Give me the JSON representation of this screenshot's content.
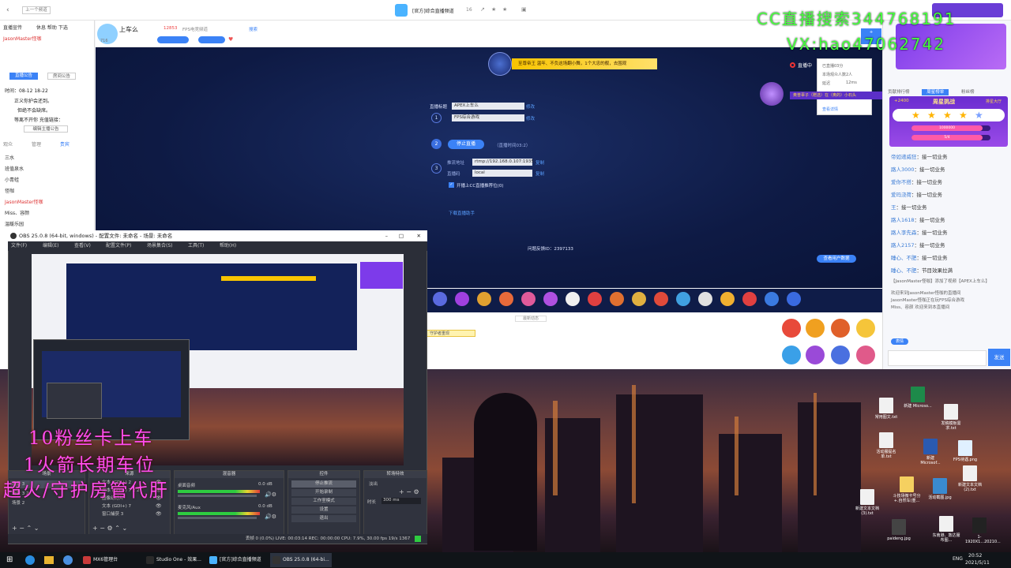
{
  "overlay": {
    "cc_line": "CC直播搜索344768191",
    "vx_line": "VX:hao47062742",
    "fans_line": "10粉丝卡上车",
    "rocket_line": "1火箭长期车位",
    "super_line": "超火/守护房管代肝"
  },
  "cc": {
    "back_label": "上一个频道",
    "room_title": "[官方]综合直播频道",
    "room_count": "16",
    "tabs": [
      "直播宣传",
      "休息",
      "帮助",
      "下选"
    ],
    "host_name": "JasonMaster怪咖",
    "stage_title": "上车么",
    "hot_count": "12853",
    "fps_label": "FPS电竞频道",
    "search_label": "搜索",
    "level_badge": "716",
    "banner_text": "至尊帝王 温年、不负这场翻小舞，1个大忠的舰，去围观",
    "live_status": "直播中",
    "live_time": "已直播03分",
    "viewers_label": "本场观众人数2人",
    "delay_label": "延迟",
    "delay_value": "12ms",
    "feedback_label": "查看详情",
    "announce_user": "奥普辜子（赠选）在（奥的）小石头",
    "form": {
      "title_label": "直播标题",
      "title_value": "APEX上车么",
      "title_edit": "修改",
      "game_value": "FPS综合游戏",
      "game_edit": "修改",
      "stop_button": "停止直播",
      "stop_hint": "（直播时间03:2）",
      "rtmp_label": "推流地址",
      "rtmp_value": "rtmp://192.168.0.107:1935",
      "rtmp_copy": "复制",
      "key_label": "直播码",
      "key_value": "local",
      "key_copy": "复制",
      "share_check": "开播上CC直播推荐位(0)",
      "download_link": "下载直播助手",
      "records": "问题反馈ID：2397133",
      "obs_button": "查看用户数据"
    },
    "left_panel": {
      "mode_tabs": [
        "直播公告",
        "房间公告"
      ],
      "time_label": "时间：08-12 18-22",
      "notes": [
        "正义你护会还到。",
        "但绝不会缺席。",
        "等离不开你 充值链接："
      ],
      "edit_button": "编辑主播公告",
      "member_tabs": [
        "观众",
        "管理",
        "贵宾"
      ],
      "members": [
        "三水",
        "班值泉水",
        "小青蛙",
        "怪咖",
        "JasonMaster怪咖",
        "Miss、容颜",
        "温暖乐园"
      ]
    },
    "right_panel": {
      "rank_tabs": [
        "贡献排行榜",
        "周星榜单",
        "粉丝榜"
      ],
      "star_title": "周星挑战",
      "star_count": "+2400",
      "star_rank": "排星大厅",
      "progress_1": "1000000",
      "progress_2": "5/4",
      "chat": [
        {
          "user": "帝如递威狂",
          "text": "接一切业务"
        },
        {
          "user": "路人3000",
          "text": "接一切业务"
        },
        {
          "user": "爱你不搭",
          "text": "接一切业务"
        },
        {
          "user": "爱玛浇荷",
          "text": "接一切业务"
        },
        {
          "user": "王",
          "text": "接一切业务"
        },
        {
          "user": "路人1618",
          "text": "接一切业务"
        },
        {
          "user": "路人李先森",
          "text": "接一切业务"
        },
        {
          "user": "路人2157",
          "text": "接一切业务"
        },
        {
          "user": "睡心、不肥",
          "text": "接一切业务"
        },
        {
          "user": "睡心、不肥",
          "text": "节目效果拉满"
        }
      ],
      "system_msg_1": "【JasonMaster怪咖】添加了视频【APEX上车么】",
      "system_msg_2": "欢迎来到JasonMaster怪咖的直播间",
      "system_msg_3": "JasonMaster怪咖正在玩FPS综合游戏",
      "system_msg_4": "Miss、容颜 欢迎来到本直播间",
      "send_button": "发送",
      "input_tab": "表情"
    },
    "under_tabs": [
      "最新动态"
    ],
    "gift_tip": "守护者重现"
  },
  "obs": {
    "title": "OBS 25.0.8 (64-bit, windows) - 配置文件: 未命名 - 场景: 未命名",
    "menu": [
      "文件(F)",
      "编辑(E)",
      "查看(V)",
      "配置文件(P)",
      "场景集合(S)",
      "工具(T)",
      "帮助(H)"
    ],
    "docks": {
      "scenes": "场景",
      "sources": "来源",
      "mixer": "混音器",
      "transitions": "转场特效",
      "controls": "控件"
    },
    "scene_items": [
      "场景 3",
      "场景 3 2",
      "场景 2"
    ],
    "source_items": [
      "文本 (GDI+) 2",
      "文本 (GDI+) 7 2 2",
      "图像幻灯片",
      "文本 (GDI+) 7",
      "窗口捕获 3"
    ],
    "mixer_items": [
      "桌面音频",
      "麦克风/Aux"
    ],
    "mixer_db": "0.0 dB",
    "control_buttons": [
      "停止推流",
      "开始录制",
      "工作室模式",
      "设置",
      "退出"
    ],
    "transition_label": "淡出",
    "duration_label": "时长",
    "duration_value": "300 ms",
    "status": "丢帧 0 (0.0%)   LIVE: 00:03:14   REC: 00:00:00   CPU: 7.9%, 30.00 fps   19/s 1367"
  },
  "desktop_icons": [
    "常用图文.txt",
    "新建 Microso...",
    "发稿模板需求.txt",
    "活动服提名单.txt",
    "新建 Microsof...",
    "FPS待遇.png",
    "斗技场微卡号分+.自然车(重...",
    "活动截图.jpg",
    "新建文本文档 (2).txt",
    "新建文本文档 (3).txt",
    "paideng.jpg",
    "东南港、敦达服布图...",
    "1-1920X1...20210..."
  ],
  "taskbar": {
    "apps": [
      "MX6管理台",
      "Studio One - 效果...",
      "[官方]综合直播频道",
      "OBS 25.0.8 (64-bi..."
    ],
    "lang": "ENG",
    "time": "20:52",
    "date": "2021/5/11"
  }
}
